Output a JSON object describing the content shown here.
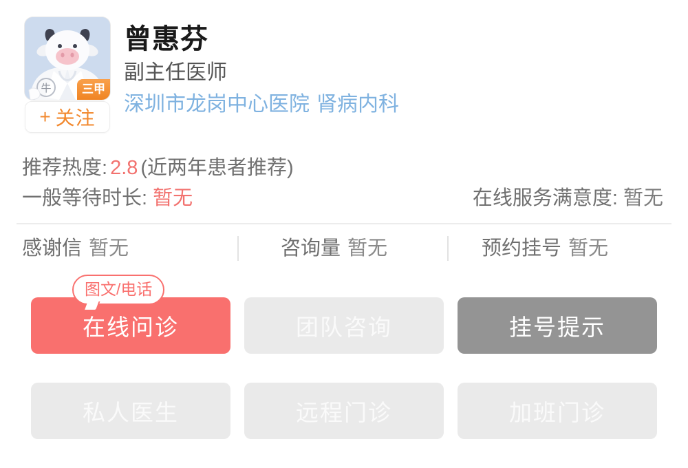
{
  "profile": {
    "avatar_alt": "cow-doctor-avatar",
    "hospital_grade_badge": "三甲",
    "emblem_text": "牛",
    "follow_button": {
      "plus": "+",
      "label": "关注"
    },
    "name": "曾惠芬",
    "title": "副主任医师",
    "hospital": "深圳市龙岗中心医院",
    "department": "肾病内科"
  },
  "metrics": {
    "recommend_label": "推荐热度:",
    "recommend_value": "2.8",
    "recommend_note": "(近两年患者推荐)",
    "wait_label": "一般等待时长:",
    "wait_value": "暂无",
    "satisfaction_label": "在线服务满意度:",
    "satisfaction_value": "暂无"
  },
  "stats": [
    {
      "label": "感谢信",
      "value": "暂无"
    },
    {
      "label": "咨询量",
      "value": "暂无"
    },
    {
      "label": "预约挂号",
      "value": "暂无"
    }
  ],
  "actions": {
    "tooltip": "图文/电话",
    "row1": [
      {
        "label": "在线问诊",
        "state": "primary"
      },
      {
        "label": "团队咨询",
        "state": "disabled"
      },
      {
        "label": "挂号提示",
        "state": "dark"
      }
    ],
    "row2": [
      {
        "label": "私人医生",
        "state": "disabled"
      },
      {
        "label": "远程门诊",
        "state": "disabled"
      },
      {
        "label": "加班门诊",
        "state": "disabled"
      }
    ]
  },
  "colors": {
    "primary": "#f9706e",
    "dark": "#949494",
    "disabled": "#eaeaea",
    "accent_orange": "#f2892f",
    "link_blue": "#7fb2e0",
    "text_gray": "#6a6a6a"
  }
}
